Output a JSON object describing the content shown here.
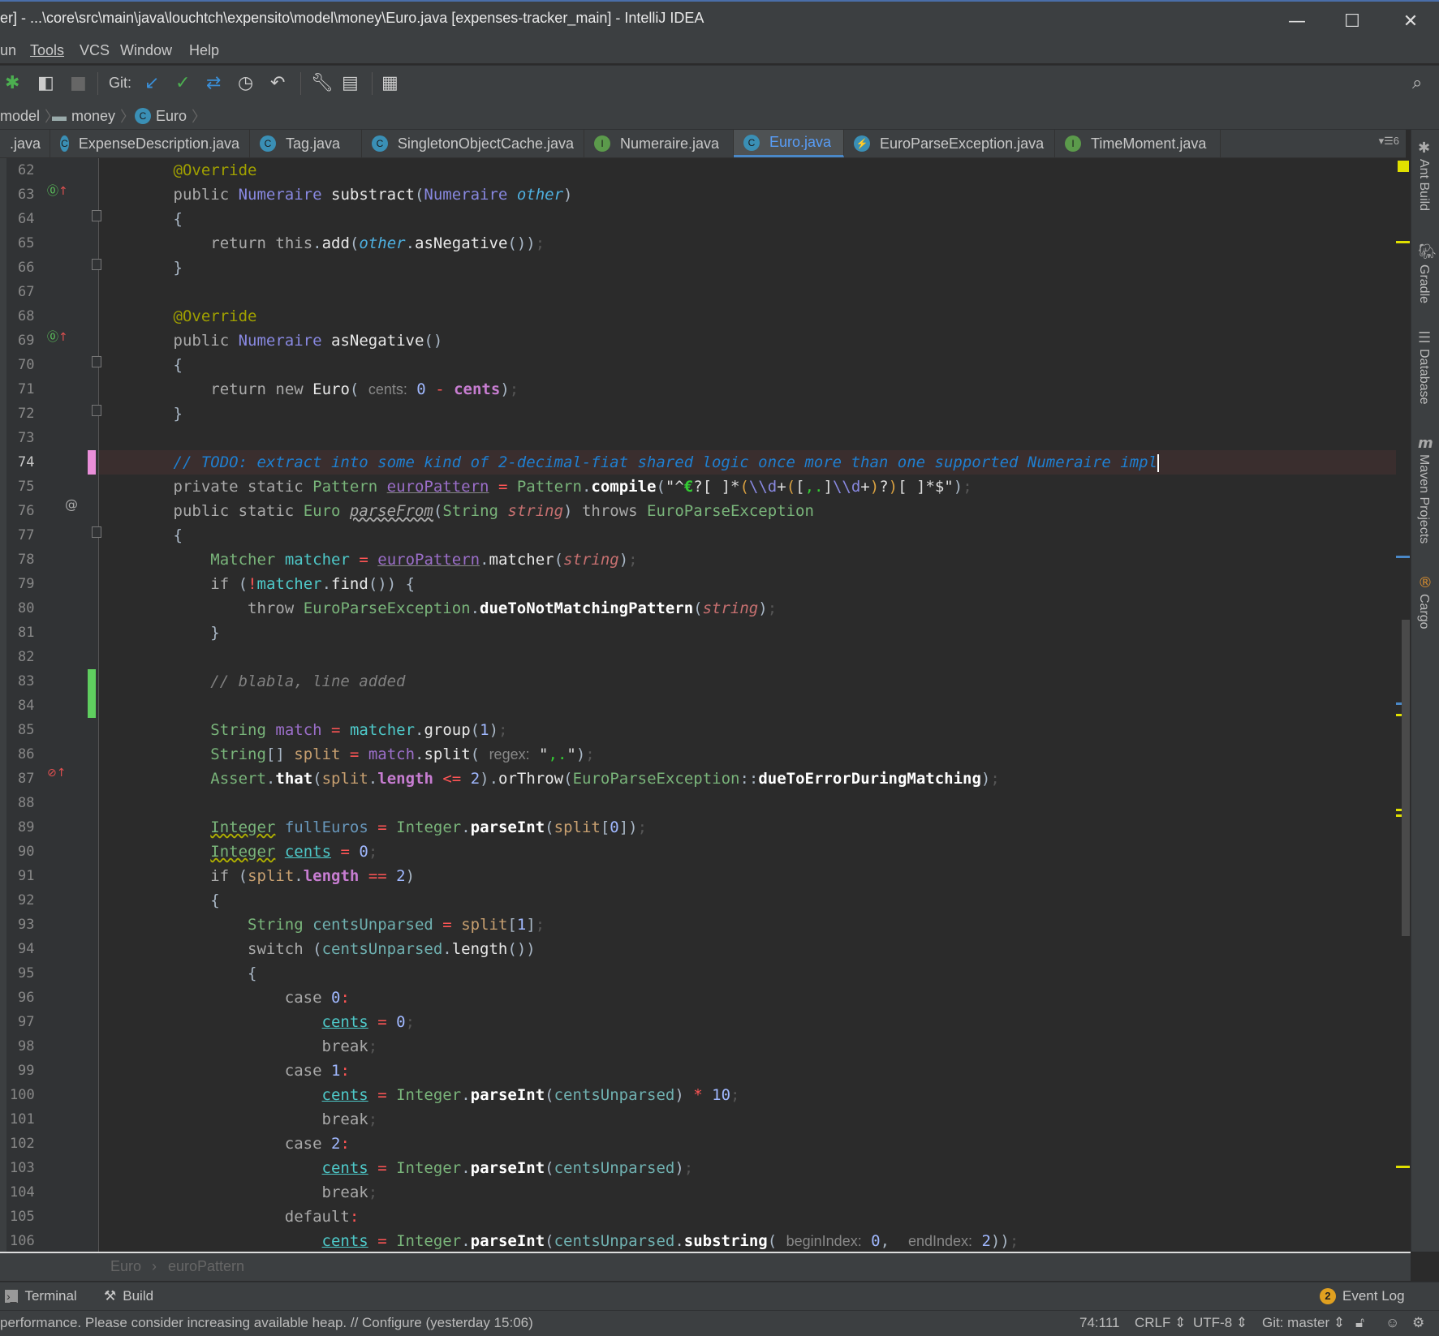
{
  "window": {
    "title": "er] - ...\\core\\src\\main\\java\\louchtch\\expensito\\model\\money\\Euro.java [expenses-tracker_main] - IntelliJ IDEA",
    "minimize": "—",
    "maximize": "☐",
    "close": "✕"
  },
  "menu": [
    "un",
    "Tools",
    "VCS",
    "Window",
    "Help"
  ],
  "toolbar": {
    "git_label": "Git:",
    "icons": [
      "debug-icon",
      "coverage-icon",
      "stop-icon",
      "vcs-update-icon",
      "vcs-commit-icon",
      "vcs-compare-icon",
      "history-icon",
      "revert-icon",
      "settings-wrench-icon",
      "project-structure-icon",
      "sdk-icon",
      "search-everywhere-icon"
    ]
  },
  "breadcrumb": [
    "model",
    "money",
    "Euro"
  ],
  "tabs": [
    {
      "label": ".java",
      "icon": "",
      "active": false
    },
    {
      "label": "ExpenseDescription.java",
      "icon": "C",
      "active": false
    },
    {
      "label": "Tag.java",
      "icon": "C",
      "active": false
    },
    {
      "label": "SingletonObjectCache.java",
      "icon": "C",
      "active": false
    },
    {
      "label": "Numeraire.java",
      "icon": "I",
      "active": false
    },
    {
      "label": "Euro.java",
      "icon": "C",
      "active": true
    },
    {
      "label": "EuroParseException.java",
      "icon": "⚡",
      "active": false
    },
    {
      "label": "TimeMoment.java",
      "icon": "I",
      "active": false
    }
  ],
  "tab_overflow_count": "6",
  "editor": {
    "line_numbers": [
      "62",
      "63",
      "64",
      "65",
      "66",
      "67",
      "68",
      "69",
      "70",
      "71",
      "72",
      "73",
      "74",
      "75",
      "76",
      "77",
      "78",
      "79",
      "80",
      "81",
      "82",
      "83",
      "84",
      "85",
      "86",
      "87",
      "88",
      "89",
      "90",
      "91",
      "92",
      "93",
      "94",
      "95",
      "96",
      "97",
      "98",
      "99",
      "100",
      "101",
      "102",
      "103",
      "104",
      "105",
      "106"
    ],
    "current_line": "74",
    "todo_comment": "// TODO: extract into some kind of 2-decimal-fiat shared logic once more than one supported Numeraire impl",
    "added_comment": "// blabla, line added",
    "hints": {
      "cents": "cents:",
      "regex": "regex:",
      "beginIndex": "beginIndex:",
      "endIndex": "endIndex:"
    }
  },
  "bottom_breadcrumb": [
    "Euro",
    "euroPattern"
  ],
  "tool_windows": {
    "terminal": "Terminal",
    "build": "Build",
    "event_log": "Event Log",
    "event_count": "2"
  },
  "right_tools": [
    "Ant Build",
    "Gradle",
    "Database",
    "Maven Projects",
    "Cargo"
  ],
  "status": {
    "message": "performance. Please consider increasing available heap. // Configure (yesterday 15:06)",
    "position": "74:111",
    "line_sep": "CRLF",
    "encoding": "UTF-8",
    "vcs": "Git: master"
  },
  "colors": {
    "accent": "#4a88c7",
    "todo": "#1f7fd0",
    "vcs_added": "#5fce5f",
    "vcs_modified": "#e98fd9",
    "warning_mark": "#e0e000"
  }
}
